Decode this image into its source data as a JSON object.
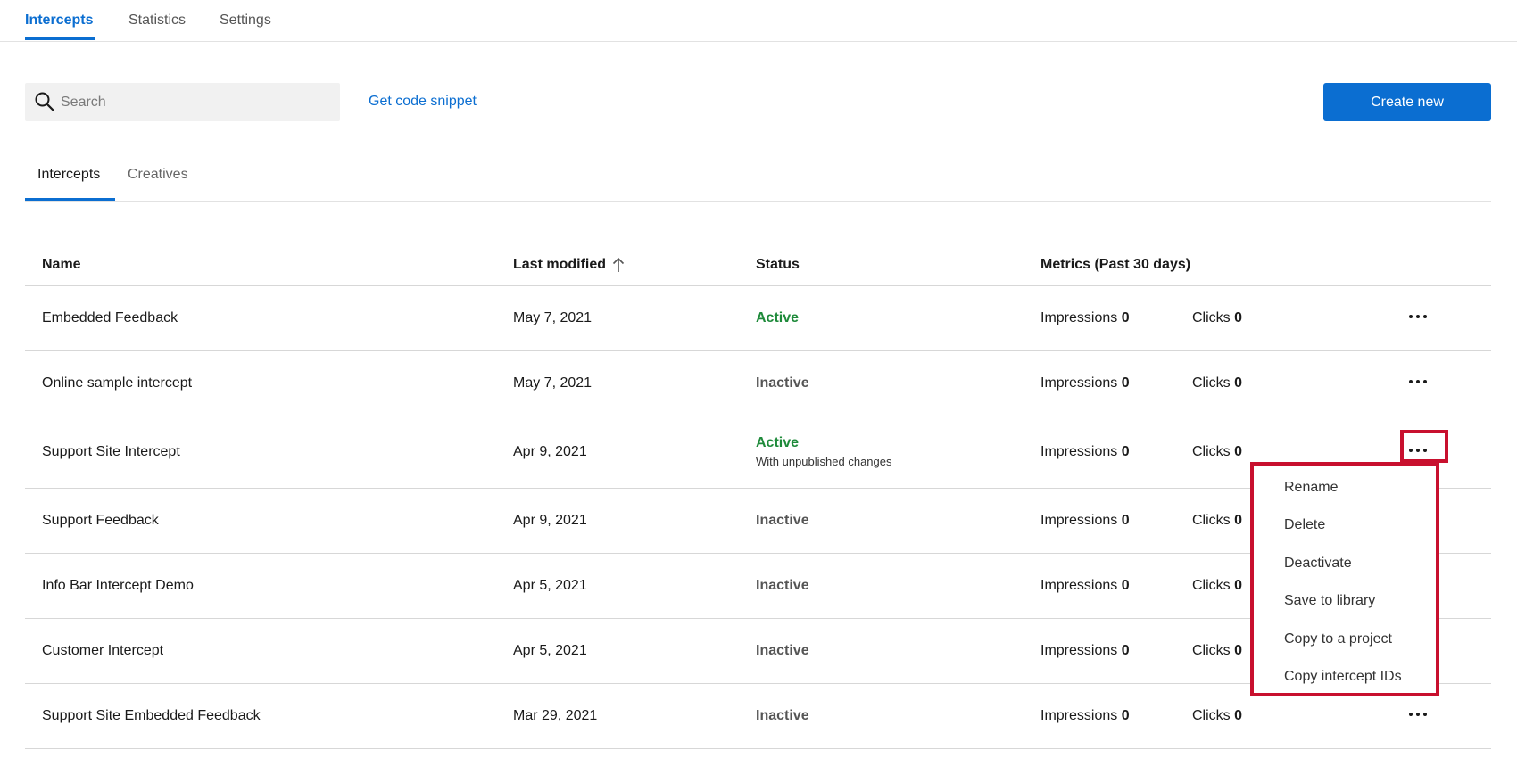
{
  "top_nav": {
    "tabs": [
      "Intercepts",
      "Statistics",
      "Settings"
    ],
    "active": "Intercepts"
  },
  "toolbar": {
    "search_placeholder": "Search",
    "snippet_link": "Get code snippet",
    "create_button": "Create new"
  },
  "sub_tabs": {
    "tabs": [
      "Intercepts",
      "Creatives"
    ],
    "active": "Intercepts"
  },
  "table": {
    "headers": {
      "name": "Name",
      "last_modified": "Last modified",
      "status": "Status",
      "metrics": "Metrics (Past 30 days)"
    },
    "metric_labels": {
      "impressions": "Impressions",
      "clicks": "Clicks"
    },
    "rows": [
      {
        "name": "Embedded Feedback",
        "date": "May 7, 2021",
        "status": "Active",
        "status_note": "",
        "impressions": "0",
        "clicks": "0"
      },
      {
        "name": "Online sample intercept",
        "date": "May 7, 2021",
        "status": "Inactive",
        "status_note": "",
        "impressions": "0",
        "clicks": "0"
      },
      {
        "name": "Support Site Intercept",
        "date": "Apr 9, 2021",
        "status": "Active",
        "status_note": "With unpublished changes",
        "impressions": "0",
        "clicks": "0"
      },
      {
        "name": "Support Feedback",
        "date": "Apr 9, 2021",
        "status": "Inactive",
        "status_note": "",
        "impressions": "0",
        "clicks": "0"
      },
      {
        "name": "Info Bar Intercept Demo",
        "date": "Apr 5, 2021",
        "status": "Inactive",
        "status_note": "",
        "impressions": "0",
        "clicks": "0"
      },
      {
        "name": "Customer Intercept",
        "date": "Apr 5, 2021",
        "status": "Inactive",
        "status_note": "",
        "impressions": "0",
        "clicks": "0"
      },
      {
        "name": "Support Site Embedded Feedback",
        "date": "Mar 29, 2021",
        "status": "Inactive",
        "status_note": "",
        "impressions": "0",
        "clicks": "0"
      }
    ]
  },
  "context_menu": {
    "items": [
      "Rename",
      "Delete",
      "Deactivate",
      "Save to library",
      "Copy to a project",
      "Copy intercept IDs"
    ]
  },
  "colors": {
    "accent": "#0b6ed1",
    "active_status": "#1e8a3a",
    "highlight": "#c8102e"
  },
  "icons": {
    "search": "search-icon",
    "sort": "arrow-up-icon",
    "more": "more-horizontal-icon"
  }
}
